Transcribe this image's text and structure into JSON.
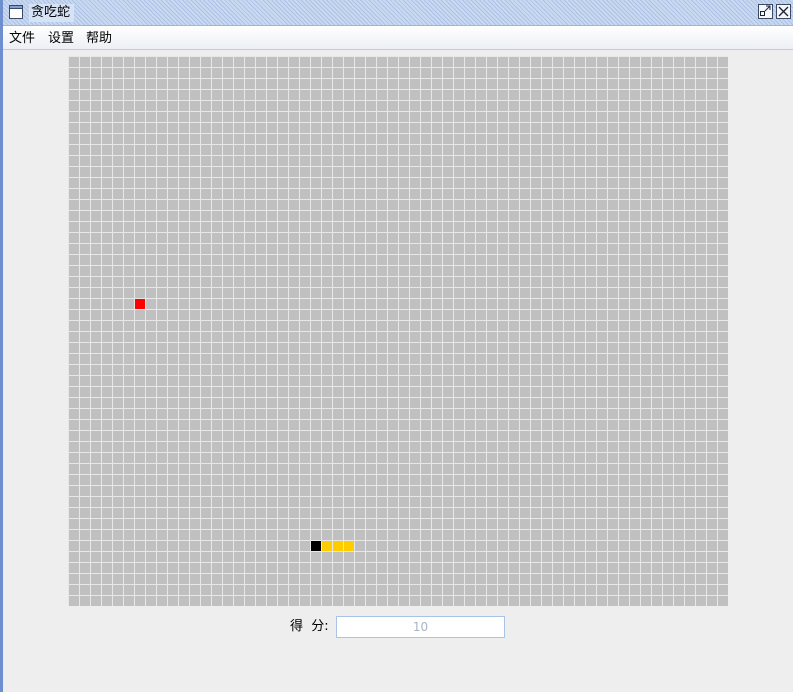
{
  "window": {
    "title": "贪吃蛇"
  },
  "menu": {
    "file": "文件",
    "settings": "设置",
    "help": "帮助"
  },
  "board": {
    "columns": 60,
    "rows": 50,
    "cell_color": "#c0c0c0",
    "grid_line_color": "#e8e8e8",
    "food": {
      "col": 6,
      "row": 22,
      "color": "#ff0000"
    },
    "snake": {
      "head_color": "#000000",
      "body_color": "#ffcc00",
      "segments": [
        {
          "col": 22,
          "row": 44
        },
        {
          "col": 23,
          "row": 44
        },
        {
          "col": 24,
          "row": 44
        },
        {
          "col": 25,
          "row": 44
        }
      ]
    }
  },
  "score": {
    "label": "得  分:",
    "value": "10"
  }
}
